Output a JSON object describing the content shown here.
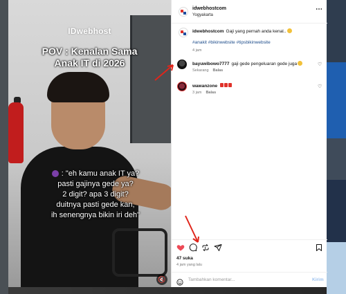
{
  "media": {
    "watermark": "IDwebhost",
    "title_lines": [
      "POV : Kenalan Sama",
      "Anak IT di 2026"
    ],
    "caption_lines": [
      ": \"eh kamu anak IT ya?",
      "pasti gajinya gede ya?",
      "2 digit? apa 3 digit?",
      "duitnya pasti gede kan,",
      "ih senengnya bikin iri deh\""
    ],
    "mute_icon": "speaker-muted-icon"
  },
  "header": {
    "username": "idwebhostcom",
    "location": "Yogyakarta",
    "more_icon": "ellipsis-icon"
  },
  "post": {
    "username": "idwebhostcom",
    "text": "Gaji yang pernah anda kenal..",
    "tags": "#anakit #bikinwebsite #tipsbikinwebsite",
    "time": "4 jam"
  },
  "comments": [
    {
      "username": "bayuwibowo7777",
      "text": "gaji gede pengeluaran gede juga",
      "time": "Sekarang",
      "reply": "Balas"
    },
    {
      "username": "wawanzone",
      "text": "",
      "time": "3 jam",
      "reply": "Balas"
    }
  ],
  "actions": {
    "likes": "47 suka",
    "ago": "4 jam yang lalu"
  },
  "add_comment": {
    "placeholder": "Tambahkan komentar...",
    "post_label": "Kirim"
  },
  "colors": {
    "like_red": "#ed4956",
    "link_blue": "#1e4d8b",
    "annotation_red": "#e0251b"
  }
}
